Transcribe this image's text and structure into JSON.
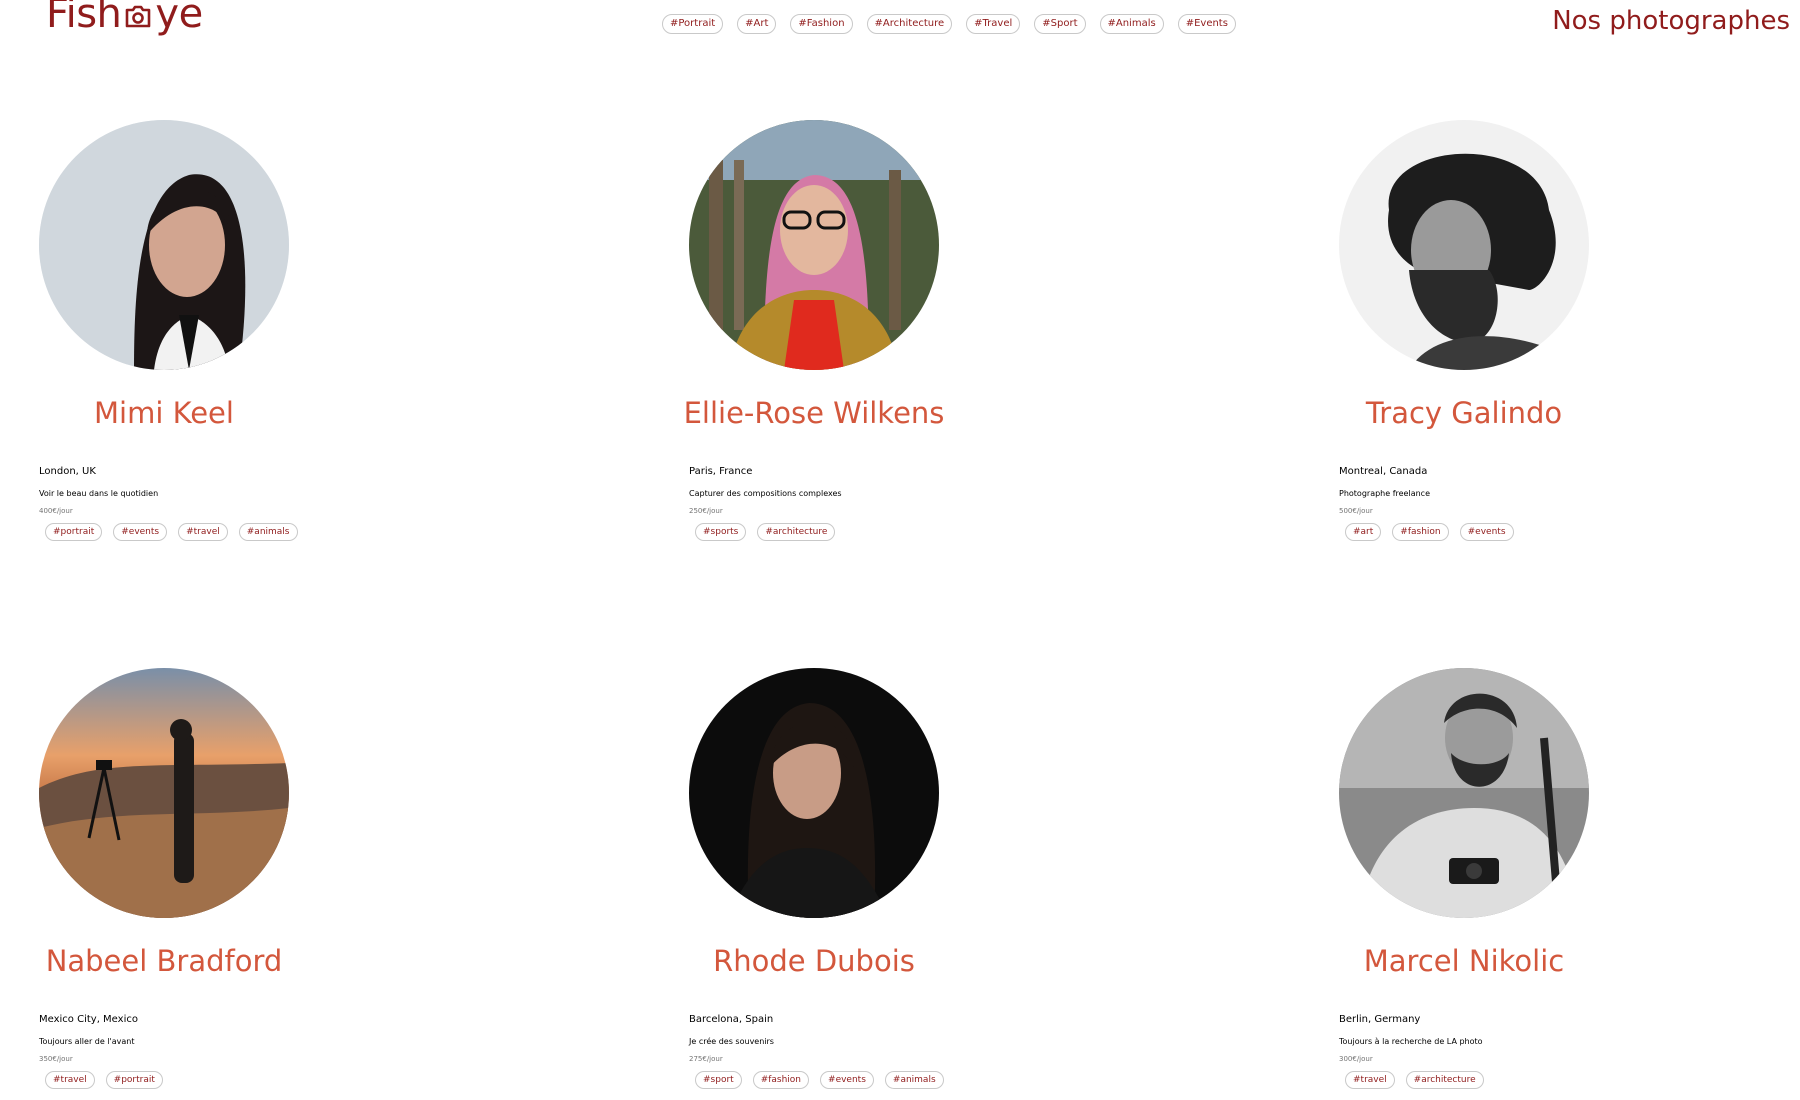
{
  "header": {
    "logo_text_left": "Fish",
    "logo_text_right": "ye",
    "nav_tags": [
      "#Portrait",
      "#Art",
      "#Fashion",
      "#Architecture",
      "#Travel",
      "#Sport",
      "#Animals",
      "#Events"
    ],
    "page_title": "Nos photographes"
  },
  "photographers": [
    {
      "name": "Mimi Keel",
      "location": "London, UK",
      "tagline": "Voir le beau dans le quotidien",
      "price": "400€/jour",
      "tags": [
        "#portrait",
        "#events",
        "#travel",
        "#animals"
      ]
    },
    {
      "name": "Ellie-Rose Wilkens",
      "location": "Paris, France",
      "tagline": "Capturer des compositions complexes",
      "price": "250€/jour",
      "tags": [
        "#sports",
        "#architecture"
      ]
    },
    {
      "name": "Tracy Galindo",
      "location": "Montreal, Canada",
      "tagline": "Photographe freelance",
      "price": "500€/jour",
      "tags": [
        "#art",
        "#fashion",
        "#events"
      ]
    },
    {
      "name": "Nabeel Bradford",
      "location": "Mexico City, Mexico",
      "tagline": "Toujours aller de l'avant",
      "price": "350€/jour",
      "tags": [
        "#travel",
        "#portrait"
      ]
    },
    {
      "name": "Rhode Dubois",
      "location": "Barcelona, Spain",
      "tagline": "Je crée des souvenirs",
      "price": "275€/jour",
      "tags": [
        "#sport",
        "#fashion",
        "#events",
        "#animals"
      ]
    },
    {
      "name": "Marcel Nikolic",
      "location": "Berlin, Germany",
      "tagline": "Toujours à la recherche de LA photo",
      "price": "300€/jour",
      "tags": [
        "#travel",
        "#architecture"
      ]
    }
  ]
}
